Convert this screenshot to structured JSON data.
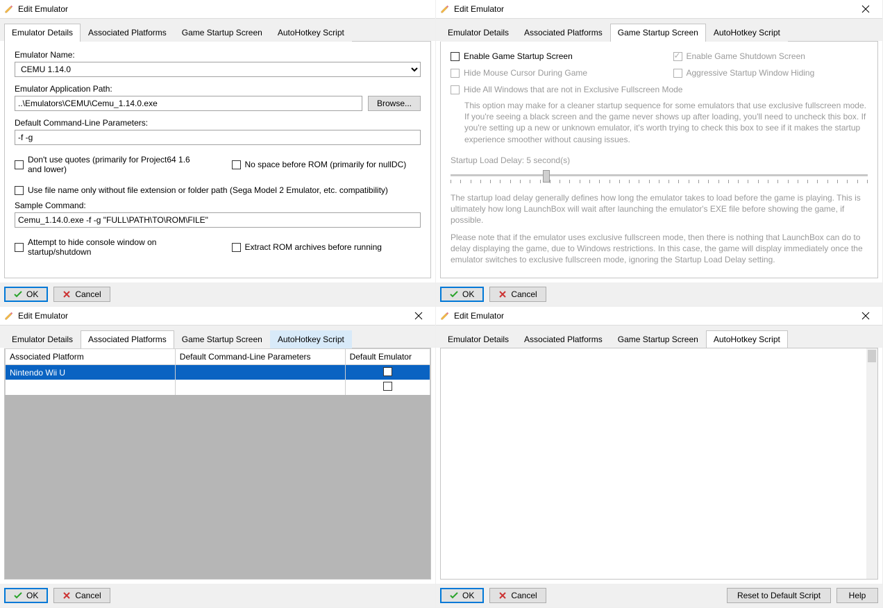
{
  "windows": {
    "title": "Edit Emulator",
    "tabs": {
      "details": "Emulator Details",
      "platforms": "Associated Platforms",
      "startup": "Game Startup Screen",
      "ahk": "AutoHotkey Script"
    }
  },
  "buttons": {
    "ok": "OK",
    "cancel": "Cancel",
    "browse": "Browse...",
    "reset_script": "Reset to Default Script",
    "help": "Help"
  },
  "details": {
    "name_label": "Emulator Name:",
    "name_value": "CEMU 1.14.0",
    "path_label": "Emulator Application Path:",
    "path_value": "..\\Emulators\\CEMU\\Cemu_1.14.0.exe",
    "params_label": "Default Command-Line Parameters:",
    "params_value": "-f -g",
    "no_quotes": "Don't use quotes (primarily for Project64 1.6 and lower)",
    "no_space": "No space before ROM (primarily for nullDC)",
    "filename_only": "Use file name only without file extension or folder path (Sega Model 2 Emulator, etc. compatibility)",
    "sample_label": "Sample Command:",
    "sample_value": "Cemu_1.14.0.exe -f -g \"FULL\\PATH\\TO\\ROM\\FILE\"",
    "hide_console": "Attempt to hide console window on startup/shutdown",
    "extract_rom": "Extract ROM archives before running"
  },
  "startup": {
    "enable_startup": "Enable Game Startup Screen",
    "enable_shutdown": "Enable Game Shutdown Screen",
    "hide_cursor": "Hide Mouse Cursor During Game",
    "aggressive_hide": "Aggressive Startup Window Hiding",
    "hide_all_windows": "Hide All Windows that are not in Exclusive Fullscreen Mode",
    "hide_all_help": "This option may make for a cleaner startup sequence for some emulators that use exclusive fullscreen mode. If you're seeing a black screen and the game never shows up after loading, you'll need to uncheck this box. If you're setting up a new or unknown emulator, it's worth trying to check this box to see if it makes the startup experience smoother without causing issues.",
    "delay_label": "Startup Load Delay: 5 second(s)",
    "delay_help1": "The startup load delay generally defines how long the emulator takes to load before the game is playing. This is ultimately how long LaunchBox will wait after launching the emulator's EXE file before showing the game, if possible.",
    "delay_help2": "Please note that if the emulator uses exclusive fullscreen mode, then there is nothing that LaunchBox can do to delay displaying the game, due to Windows restrictions. In this case, the game will display immediately once the emulator switches to exclusive fullscreen mode, ignoring the Startup Load Delay setting."
  },
  "platforms": {
    "col_platform": "Associated Platform",
    "col_params": "Default Command-Line Parameters",
    "col_default": "Default Emulator",
    "rows": [
      {
        "platform": "Nintendo Wii U",
        "params": "",
        "default": false
      }
    ]
  }
}
